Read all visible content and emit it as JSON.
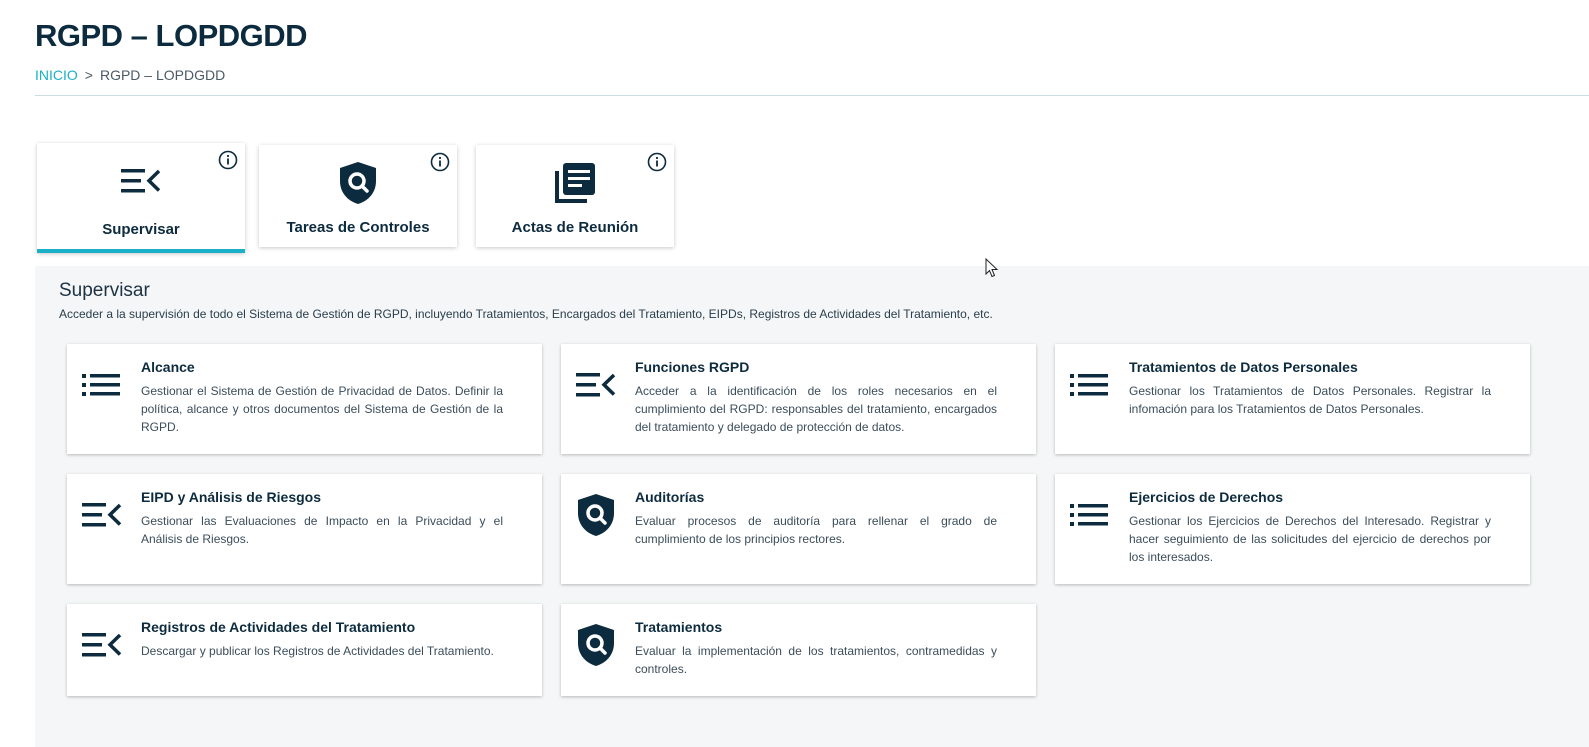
{
  "header": {
    "title": "RGPD – LOPDGDD",
    "breadcrumb": {
      "home": "INICIO",
      "separator": ">",
      "current": "RGPD – LOPDGDD"
    }
  },
  "tabs": [
    {
      "label": "Supervisar",
      "icon": "list-collapse-icon",
      "active": true
    },
    {
      "label": "Tareas de Controles",
      "icon": "shield-search-icon",
      "active": false
    },
    {
      "label": "Actas de Reunión",
      "icon": "documents-icon",
      "active": false
    }
  ],
  "section": {
    "title": "Supervisar",
    "description": "Acceder a la supervisión de todo el Sistema de Gestión de RGPD, incluyendo Tratamientos, Encargados del Tratamiento, EIPDs, Registros de Actividades del Tratamiento, etc."
  },
  "cards": [
    {
      "title": "Alcance",
      "icon": "list-icon",
      "text": "Gestionar el Sistema de Gestión de Privacidad de Datos. Definir la política, alcance y otros documentos del Sistema de Gestión de la RGPD."
    },
    {
      "title": "Funciones RGPD",
      "icon": "list-collapse-icon",
      "text": "Acceder a la identificación de los roles necesarios en el cumplimiento del RGPD: responsables del tratamiento, encargados del tratamiento y delegado de protección de datos."
    },
    {
      "title": "Tratamientos de Datos Personales",
      "icon": "list-icon",
      "text": "Gestionar los Tratamientos de Datos Personales. Registrar la infomación para los Tratamientos de Datos Personales."
    },
    {
      "title": "EIPD y Análisis de Riesgos",
      "icon": "list-collapse-icon",
      "text": "Gestionar las Evaluaciones de Impacto en la Privacidad y el Análisis de Riesgos."
    },
    {
      "title": "Auditorías",
      "icon": "shield-search-icon",
      "text": "Evaluar procesos de auditoría para rellenar el grado de cumplimiento de los principios rectores."
    },
    {
      "title": "Ejercicios de Derechos",
      "icon": "list-icon",
      "text": "Gestionar los Ejercicios de Derechos del Interesado. Registrar y hacer seguimiento de las solicitudes del ejercicio de derechos por los interesados."
    },
    {
      "title": "Registros de Actividades del Tratamiento",
      "icon": "list-collapse-icon",
      "text": "Descargar y publicar los Registros de Actividades del Tratamiento."
    },
    {
      "title": "Tratamientos",
      "icon": "shield-search-icon",
      "text": "Evaluar la implementación de los tratamientos, contramedidas y controles."
    }
  ],
  "colors": {
    "accent": "#1ab0c8",
    "dark": "#0d2b3e",
    "panel": "#f4f6f7"
  }
}
